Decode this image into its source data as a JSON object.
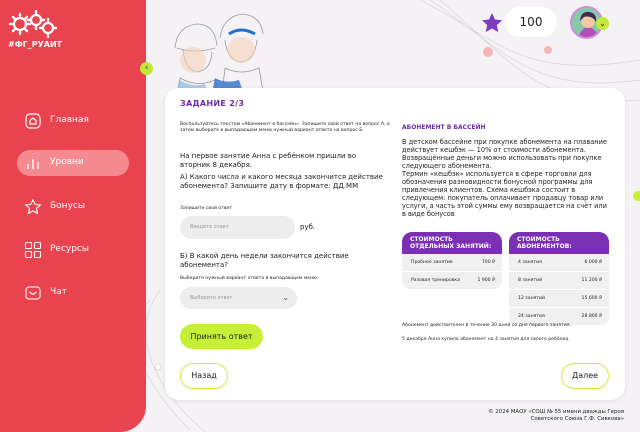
{
  "brand": {
    "text": "#ФГ_РУАИТ"
  },
  "sidebar": {
    "items": [
      {
        "label": "Главная",
        "icon": "home-icon"
      },
      {
        "label": "Уровни",
        "icon": "bar-chart-icon"
      },
      {
        "label": "Бонусы",
        "icon": "star-icon"
      },
      {
        "label": "Ресурсы",
        "icon": "grid-icon"
      },
      {
        "label": "Чат",
        "icon": "chat-icon"
      }
    ],
    "active_index": 1
  },
  "topbar": {
    "score": "100"
  },
  "colors": {
    "accent": "#e9434f",
    "lime": "#c8ef38",
    "purple": "#7a2fb5"
  },
  "task": {
    "title": "ЗАДАНИЕ  2/3",
    "instruction": "Воспользуйтесь текстом «Абонемент в бассейн». Запишите свой ответ на вопрос А, а затем выберите в выпадающем меню нужный вариант ответа на вопрос Б.",
    "intro": "На первое занятие Анна с ребёнком пришли во вторник 8 декабря.",
    "question_a": "А) Какого числа и какого месяца закончится действие абонемента? Запишите дату в формате: ДД.ММ",
    "answer_label": "Запишите свой ответ",
    "answer_placeholder": "Введите ответ",
    "unit": "руб.",
    "question_b": "Б) В какой день недели закончится действие абонемента?",
    "select_label": "Выберите нужный вариант ответа в выпадающем меню.",
    "select_placeholder": "Выберите ответ",
    "submit": "Принять ответ"
  },
  "info": {
    "title": "АБОНЕМЕНТ В БАССЕЙН",
    "p1": "В детском бассейне при покупке абонемента на плавание действует кешбэк — 10% от стоимости абонемента. Возвращённые деньги можно использовать при покупке следующего абонемента.",
    "p2": "Термин «кешбэк» используется в сфере торговли для обозначения разновидности бонусной программы для привлечения клиентов. Схема кешбэка состоит в следующем: покупатель оплачивает продавцу товар или услуги, а часть этой суммы ему возвращается на счёт или в виде бонусов",
    "table1": {
      "header": "СТОИМОСТЬ ОТДЕЛЬНЫХ ЗАНЯТИЙ:",
      "rows": [
        [
          "Пробное занятие",
          "700 ₽"
        ],
        [
          "Разовая тренировка",
          "1 900 ₽"
        ]
      ]
    },
    "table2": {
      "header": "СТОИМОСТЬ АБОНЕМЕНТОВ:",
      "rows": [
        [
          "4 занятия",
          "6 000 ₽"
        ],
        [
          "8 занятий",
          "11 200 ₽"
        ],
        [
          "12 занятий",
          "15 600 ₽"
        ],
        [
          "24 занятия",
          "28 800 ₽"
        ]
      ]
    },
    "note1": "Абонемент действителен в течение 30 дней со дня первого занятия.",
    "note2": "5 декабря Анна купила абонемент на 4 занятия для своего ребёнка."
  },
  "nav": {
    "back": "Назад",
    "next": "Далее"
  },
  "footer": {
    "line1": "© 2024 МАОУ «СОШ № 55 имени дважды Героя",
    "line2": "Советского Союза Г.Ф. Сивкова»"
  }
}
